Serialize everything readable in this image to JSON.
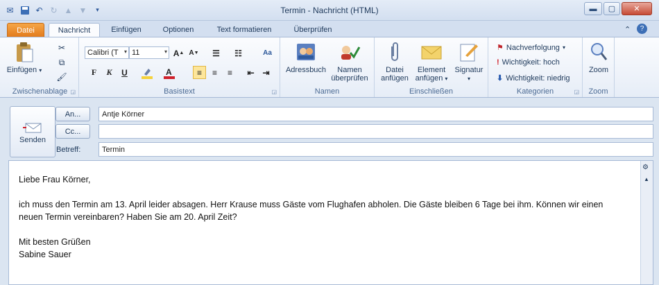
{
  "window": {
    "title": "Termin - Nachricht (HTML)"
  },
  "tabs": {
    "file": "Datei",
    "items": [
      "Nachricht",
      "Einfügen",
      "Optionen",
      "Text formatieren",
      "Überprüfen"
    ]
  },
  "ribbon": {
    "clipboard": {
      "paste": "Einfügen",
      "label": "Zwischenablage"
    },
    "basictext": {
      "font": "Calibri (T",
      "size": "11",
      "label": "Basistext"
    },
    "names": {
      "addressbook": "Adressbuch",
      "check_line1": "Namen",
      "check_line2": "überprüfen",
      "label": "Namen"
    },
    "include": {
      "attach_line1": "Datei",
      "attach_line2": "anfügen",
      "item_line1": "Element",
      "item_line2": "anfügen",
      "signature": "Signatur",
      "label": "Einschließen"
    },
    "tags": {
      "followup": "Nachverfolgung",
      "high": "Wichtigkeit: hoch",
      "low": "Wichtigkeit: niedrig",
      "label": "Kategorien"
    },
    "zoom": {
      "button": "Zoom",
      "label": "Zoom"
    }
  },
  "compose": {
    "send": "Senden",
    "to_button": "An...",
    "cc_button": "Cc...",
    "subject_label": "Betreff:",
    "to_value": "Antje Körner",
    "cc_value": "",
    "subject_value": "Termin"
  },
  "message": {
    "greeting": "Liebe Frau Körner,",
    "paragraph": "ich muss den Termin am 13. April leider absagen. Herr Krause muss Gäste vom Flughafen abholen. Die Gäste bleiben 6 Tage bei ihm. Können wir einen neuen Termin vereinbaren? Haben Sie am 20. April Zeit?",
    "closing": "Mit besten Grüßen",
    "signature": "Sabine Sauer"
  },
  "colors": {
    "file_tab": "#e1791a",
    "highlight": "#f5d23a",
    "font_color": "#d0202a",
    "followup_flag": "#c0262d"
  }
}
